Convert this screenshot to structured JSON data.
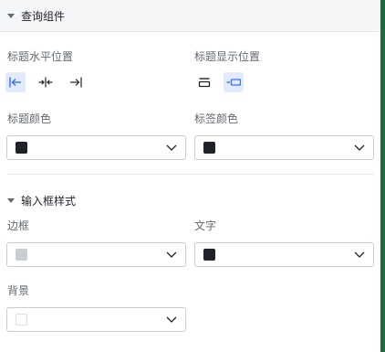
{
  "panel": {
    "header_title": "查询组件",
    "title_horizontal_label": "标题水平位置",
    "title_display_label": "标题显示位置",
    "title_color_label": "标题颜色",
    "tag_color_label": "标签颜色",
    "input_section_title": "输入框样式",
    "border_label": "边框",
    "text_label": "文字",
    "background_label": "背景"
  },
  "colors": {
    "accent": "#3370ff",
    "active_bg": "#e1eaff",
    "dark_swatch": "#1f2329",
    "border_swatch": "#c9cdd4",
    "background_swatch": "#ffffff",
    "right_bar": "#1e6b38"
  },
  "icons": {
    "align_left": "align-left-icon",
    "align_center": "align-center-icon",
    "align_right": "align-right-icon",
    "position_top": "title-top-icon",
    "position_left": "title-left-icon",
    "caret": "caret-down-icon",
    "chevron": "chevron-down-icon"
  },
  "state": {
    "title_horizontal_selected": "left",
    "title_display_selected": "left"
  }
}
